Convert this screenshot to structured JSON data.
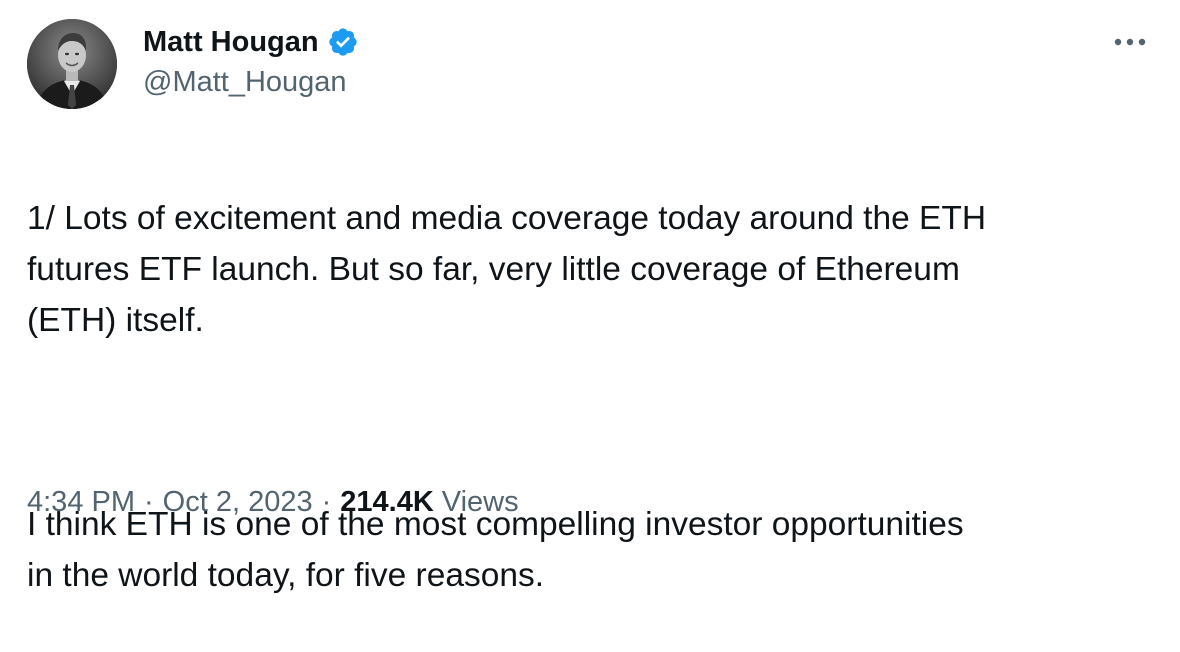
{
  "author": {
    "display_name": "Matt Hougan",
    "handle": "@Matt_Hougan",
    "verified": true
  },
  "tweet": {
    "paragraphs": [
      "1/ Lots of excitement and media coverage today around the ETH\nfutures ETF launch. But so far, very little coverage of Ethereum\n(ETH) itself.",
      "I think ETH is one of the most compelling investor opportunities\nin the world today, for five reasons."
    ],
    "time": "4:34 PM",
    "date": "Oct 2, 2023",
    "separator": "·",
    "views_count": "214.4K",
    "views_label": "Views"
  },
  "icons": {
    "verified": "verified-badge-icon",
    "more": "more-horizontal-icon",
    "avatar": "profile-photo"
  },
  "colors": {
    "text_primary": "#0f1419",
    "text_secondary": "#536471",
    "verified_blue": "#1d9bf0",
    "background": "#ffffff"
  }
}
